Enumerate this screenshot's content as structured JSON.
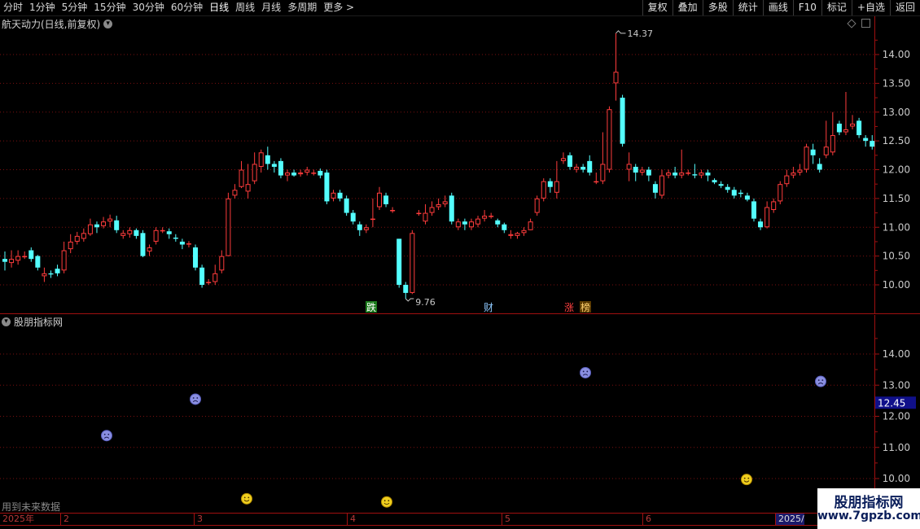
{
  "toolbar": {
    "periods": [
      "分时",
      "1分钟",
      "5分钟",
      "15分钟",
      "30分钟",
      "60分钟",
      "日线",
      "周线",
      "月线",
      "多周期",
      "更多 >"
    ],
    "active_period": "日线",
    "buttons": [
      "复权",
      "叠加",
      "多股",
      "统计",
      "画线",
      "F10",
      "标记",
      "+自选",
      "返回"
    ]
  },
  "main_panel": {
    "title": "航天动力(日线,前复权)",
    "price_axis": [
      "14.00",
      "13.50",
      "13.00",
      "12.50",
      "12.00",
      "11.50",
      "11.00",
      "10.50",
      "10.00"
    ],
    "high_label": "14.37",
    "low_label": "9.76",
    "markers": [
      {
        "text": "跌",
        "bg": "#1b7a1b",
        "color": "#ffffff"
      },
      {
        "text": "财",
        "bg": "#000000",
        "color": "#8ec9ff"
      },
      {
        "text": "涨",
        "bg": "#000000",
        "color": "#ff4040"
      },
      {
        "text": "榜",
        "bg": "#5a3a00",
        "color": "#ffd070"
      }
    ]
  },
  "indicator_panel": {
    "title": "股朋指标网",
    "axis": [
      "14.00",
      "13.00",
      "12.00",
      "11.00",
      "10.00"
    ],
    "current_value": "12.45",
    "future_note": "用到未来数据",
    "sad_color": "#8a8fe0",
    "happy_color": "#f0d020"
  },
  "date_axis": {
    "labels": [
      "2025年",
      "2",
      "3",
      "4",
      "5",
      "6",
      "2025/"
    ]
  },
  "watermark": {
    "title": "股朋指标网",
    "url": "www.7gpzb.com"
  },
  "colors": {
    "up": "#ff3c3c",
    "down": "#54ffff",
    "grid": "#7a1010",
    "background": "#000000"
  },
  "chart_data": {
    "type": "candlestick",
    "ylim": [
      9.6,
      14.6
    ],
    "candles": [
      [
        10.45,
        10.4,
        10.58,
        10.25
      ],
      [
        10.38,
        10.45,
        10.6,
        10.3
      ],
      [
        10.42,
        10.5,
        10.6,
        10.35
      ],
      [
        10.5,
        10.5,
        10.58,
        10.45
      ],
      [
        10.6,
        10.45,
        10.65,
        10.4
      ],
      [
        10.5,
        10.3,
        10.52,
        10.25
      ],
      [
        10.15,
        10.2,
        10.3,
        10.05
      ],
      [
        10.2,
        10.18,
        10.25,
        10.12
      ],
      [
        10.28,
        10.2,
        10.35,
        10.15
      ],
      [
        10.25,
        10.6,
        10.75,
        10.2
      ],
      [
        10.62,
        10.75,
        10.88,
        10.55
      ],
      [
        10.75,
        10.85,
        10.92,
        10.7
      ],
      [
        10.8,
        10.9,
        10.98,
        10.75
      ],
      [
        10.88,
        11.05,
        11.15,
        10.85
      ],
      [
        11.05,
        11.0,
        11.1,
        10.9
      ],
      [
        11.02,
        11.1,
        11.18,
        10.98
      ],
      [
        11.1,
        11.15,
        11.22,
        11.0
      ],
      [
        11.12,
        10.95,
        11.2,
        10.9
      ],
      [
        10.85,
        10.9,
        10.95,
        10.8
      ],
      [
        10.88,
        10.95,
        11.0,
        10.82
      ],
      [
        10.95,
        10.85,
        10.98,
        10.8
      ],
      [
        10.9,
        10.5,
        10.95,
        10.48
      ],
      [
        10.58,
        10.65,
        10.7,
        10.5
      ],
      [
        10.75,
        10.95,
        11.0,
        10.7
      ],
      [
        10.95,
        10.95,
        11.0,
        10.9
      ],
      [
        10.93,
        10.88,
        10.98,
        10.8
      ],
      [
        10.82,
        10.8,
        10.88,
        10.75
      ],
      [
        10.75,
        10.7,
        10.8,
        10.62
      ],
      [
        10.7,
        10.72,
        10.76,
        10.65
      ],
      [
        10.65,
        10.3,
        10.7,
        10.25
      ],
      [
        10.3,
        10.0,
        10.35,
        9.95
      ],
      [
        10.05,
        10.05,
        10.1,
        10.0
      ],
      [
        10.05,
        10.2,
        10.35,
        10.0
      ],
      [
        10.25,
        10.5,
        10.6,
        10.2
      ],
      [
        10.5,
        11.5,
        11.6,
        10.5
      ],
      [
        11.55,
        11.65,
        11.75,
        11.5
      ],
      [
        11.7,
        12.0,
        12.15,
        11.68
      ],
      [
        11.62,
        11.75,
        12.1,
        11.5
      ],
      [
        11.8,
        12.1,
        12.3,
        11.75
      ],
      [
        12.05,
        12.3,
        12.35,
        11.95
      ],
      [
        12.25,
        12.1,
        12.4,
        12.0
      ],
      [
        12.1,
        12.05,
        12.15,
        11.95
      ],
      [
        12.15,
        11.9,
        12.2,
        11.85
      ],
      [
        11.9,
        11.95,
        12.0,
        11.8
      ],
      [
        11.95,
        11.9,
        12.0,
        11.88
      ],
      [
        11.92,
        11.95,
        12.0,
        11.88
      ],
      [
        11.95,
        12.0,
        12.05,
        11.9
      ],
      [
        11.95,
        11.95,
        12.0,
        11.9
      ],
      [
        11.98,
        11.9,
        12.02,
        11.85
      ],
      [
        11.95,
        11.45,
        12.0,
        11.4
      ],
      [
        11.5,
        11.6,
        11.65,
        11.45
      ],
      [
        11.6,
        11.5,
        11.65,
        11.45
      ],
      [
        11.5,
        11.25,
        11.55,
        11.2
      ],
      [
        11.25,
        11.1,
        11.3,
        11.05
      ],
      [
        11.05,
        10.95,
        11.1,
        10.85
      ],
      [
        10.95,
        11.0,
        11.05,
        10.9
      ],
      [
        11.15,
        11.15,
        11.5,
        11.0
      ],
      [
        11.35,
        11.6,
        11.7,
        11.3
      ],
      [
        11.55,
        11.4,
        11.6,
        11.35
      ],
      [
        11.3,
        11.3,
        11.35,
        11.25
      ],
      [
        10.8,
        10.0,
        10.8,
        9.95
      ],
      [
        10.0,
        9.86,
        10.05,
        9.76
      ],
      [
        9.86,
        10.9,
        10.95,
        9.84
      ],
      [
        11.25,
        11.25,
        11.3,
        11.2
      ],
      [
        11.1,
        11.25,
        11.4,
        11.05
      ],
      [
        11.25,
        11.35,
        11.45,
        11.2
      ],
      [
        11.35,
        11.4,
        11.5,
        11.3
      ],
      [
        11.4,
        11.45,
        11.55,
        11.35
      ],
      [
        11.55,
        11.1,
        11.6,
        11.05
      ],
      [
        11.0,
        11.1,
        11.15,
        10.95
      ],
      [
        11.1,
        11.05,
        11.15,
        10.95
      ],
      [
        11.0,
        11.1,
        11.15,
        10.95
      ],
      [
        11.05,
        11.15,
        11.2,
        11.0
      ],
      [
        11.15,
        11.2,
        11.3,
        11.1
      ],
      [
        11.2,
        11.2,
        11.25,
        11.15
      ],
      [
        11.12,
        11.05,
        11.15,
        11.0
      ],
      [
        11.05,
        10.95,
        11.08,
        10.9
      ],
      [
        10.85,
        10.88,
        10.95,
        10.8
      ],
      [
        10.85,
        10.9,
        10.92,
        10.8
      ],
      [
        10.9,
        10.95,
        11.0,
        10.85
      ],
      [
        10.95,
        11.1,
        11.15,
        10.95
      ],
      [
        11.25,
        11.5,
        11.55,
        11.2
      ],
      [
        11.5,
        11.8,
        11.85,
        11.45
      ],
      [
        11.8,
        11.7,
        11.85,
        11.6
      ],
      [
        11.6,
        11.8,
        12.15,
        11.5
      ],
      [
        12.15,
        12.2,
        12.3,
        12.1
      ],
      [
        12.25,
        12.05,
        12.3,
        12.0
      ],
      [
        12.0,
        12.05,
        12.1,
        11.95
      ],
      [
        12.05,
        12.0,
        12.1,
        11.95
      ],
      [
        12.15,
        11.95,
        12.25,
        11.9
      ],
      [
        11.8,
        11.8,
        11.95,
        11.75
      ],
      [
        11.8,
        12.1,
        12.65,
        11.75
      ],
      [
        12.0,
        13.05,
        13.1,
        11.95
      ],
      [
        13.5,
        13.7,
        14.37,
        13.2
      ],
      [
        13.25,
        12.45,
        13.3,
        12.4
      ],
      [
        12.0,
        12.1,
        12.3,
        11.8
      ],
      [
        12.05,
        11.95,
        12.1,
        11.8
      ],
      [
        11.95,
        12.0,
        12.05,
        11.9
      ],
      [
        12.0,
        11.9,
        12.05,
        11.8
      ],
      [
        11.75,
        11.6,
        11.8,
        11.5
      ],
      [
        11.55,
        11.9,
        12.0,
        11.5
      ],
      [
        11.9,
        11.95,
        12.0,
        11.85
      ],
      [
        11.95,
        11.9,
        12.05,
        11.85
      ],
      [
        11.9,
        11.95,
        12.35,
        11.85
      ],
      [
        11.95,
        11.95,
        12.0,
        11.9
      ],
      [
        11.92,
        11.9,
        12.1,
        11.85
      ],
      [
        11.9,
        11.95,
        12.0,
        11.85
      ],
      [
        11.95,
        11.9,
        12.0,
        11.8
      ],
      [
        11.82,
        11.78,
        11.85,
        11.75
      ],
      [
        11.75,
        11.72,
        11.8,
        11.68
      ],
      [
        11.7,
        11.65,
        11.75,
        11.6
      ],
      [
        11.65,
        11.55,
        11.7,
        11.5
      ],
      [
        11.6,
        11.58,
        11.65,
        11.52
      ],
      [
        11.55,
        11.48,
        11.6,
        11.45
      ],
      [
        11.45,
        11.15,
        11.5,
        11.1
      ],
      [
        11.1,
        11.0,
        11.15,
        10.95
      ],
      [
        11.0,
        11.35,
        11.45,
        10.98
      ],
      [
        11.3,
        11.45,
        11.5,
        11.25
      ],
      [
        11.45,
        11.75,
        11.8,
        11.4
      ],
      [
        11.75,
        11.9,
        12.0,
        11.7
      ],
      [
        11.9,
        11.95,
        12.05,
        11.85
      ],
      [
        11.95,
        12.0,
        12.1,
        11.9
      ],
      [
        12.0,
        12.4,
        12.45,
        11.95
      ],
      [
        12.35,
        12.25,
        12.45,
        12.1
      ],
      [
        12.1,
        12.0,
        12.2,
        11.95
      ],
      [
        12.25,
        12.4,
        12.85,
        12.2
      ],
      [
        12.3,
        12.6,
        13.0,
        12.25
      ],
      [
        12.8,
        12.65,
        12.85,
        12.6
      ],
      [
        12.65,
        12.7,
        13.35,
        12.6
      ],
      [
        12.75,
        12.8,
        12.95,
        12.7
      ],
      [
        12.85,
        12.6,
        12.9,
        12.55
      ],
      [
        12.55,
        12.5,
        12.6,
        12.4
      ],
      [
        12.5,
        12.4,
        12.6,
        12.35
      ]
    ],
    "signals": [
      {
        "type": "sad",
        "value": 11.38
      },
      {
        "type": "happy",
        "value": 9.35
      },
      {
        "type": "sad",
        "value": 12.55
      },
      {
        "type": "happy",
        "value": 9.25
      },
      {
        "type": "sad",
        "value": 13.4
      },
      {
        "type": "happy",
        "value": 9.97
      },
      {
        "type": "sad",
        "value": 13.12
      }
    ]
  }
}
